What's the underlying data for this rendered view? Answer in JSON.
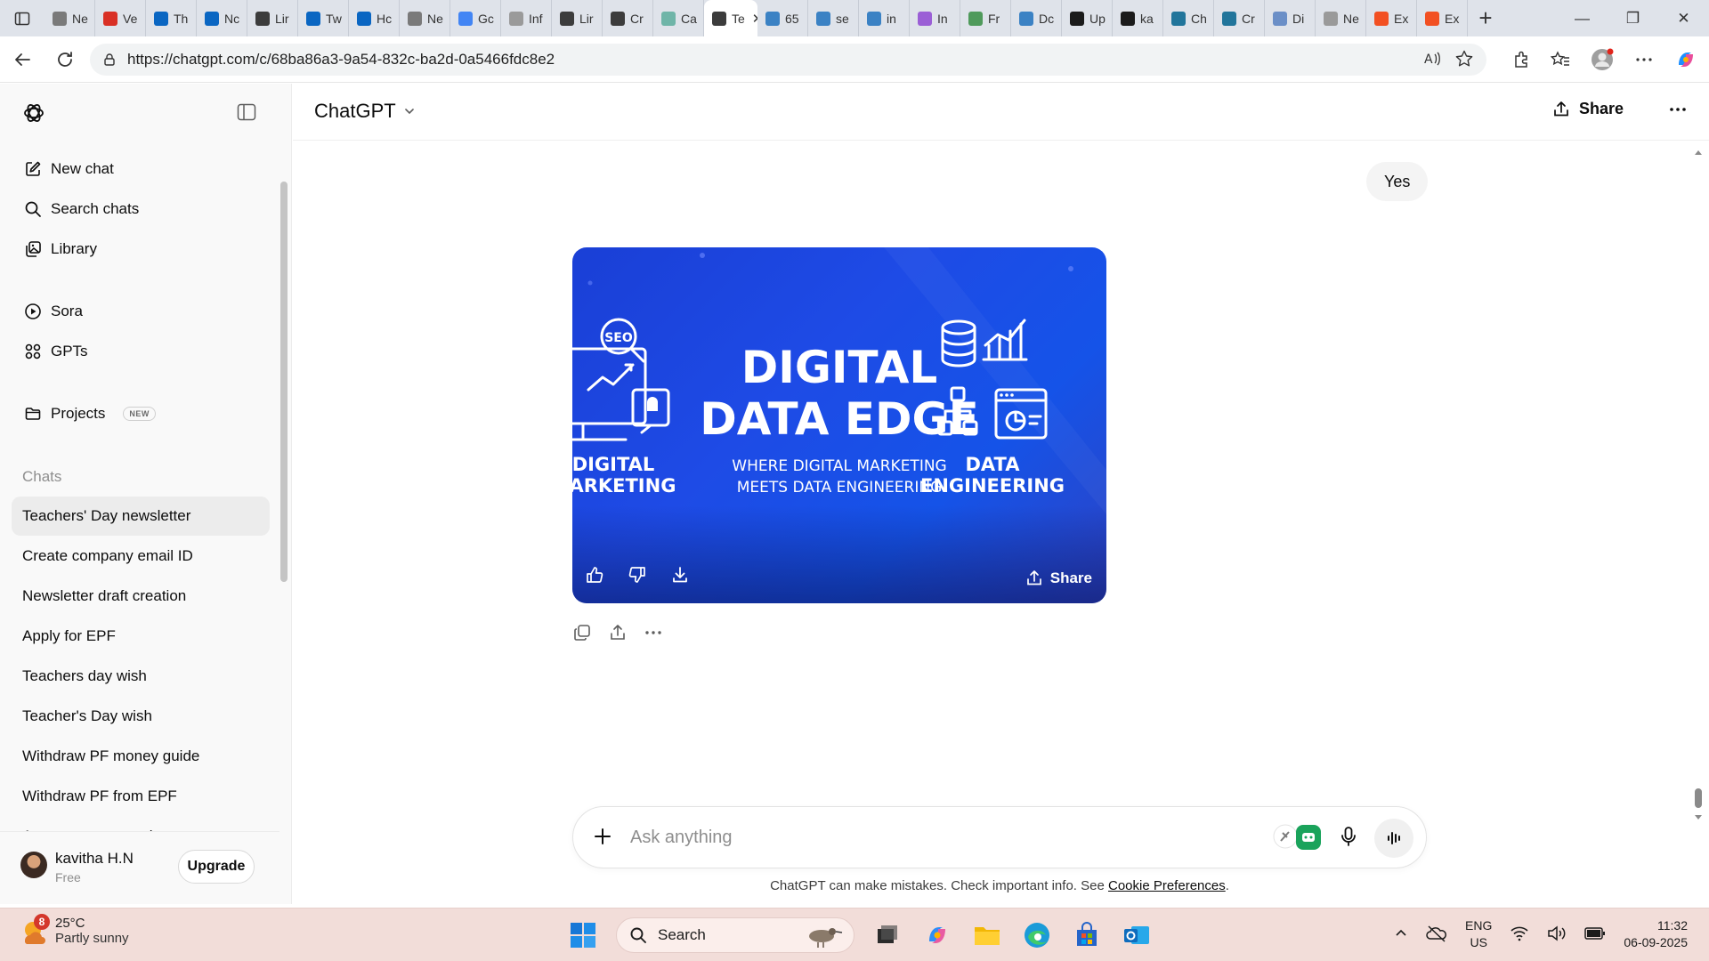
{
  "browser": {
    "tabs": [
      {
        "label": "Ne",
        "icon": "globe-icon",
        "color": "#7a7a7a"
      },
      {
        "label": "Ve",
        "icon": "gmail-icon",
        "color": "#d93025"
      },
      {
        "label": "Th",
        "icon": "linkedin-icon",
        "color": "#0a66c2"
      },
      {
        "label": "Nc",
        "icon": "linkedin-icon",
        "color": "#0a66c2"
      },
      {
        "label": "Lir",
        "icon": "chatgpt-icon",
        "color": "#3c3c3c"
      },
      {
        "label": "Tw",
        "icon": "linkedin-icon",
        "color": "#0a66c2"
      },
      {
        "label": "Hc",
        "icon": "linkedin-icon",
        "color": "#0a66c2"
      },
      {
        "label": "Ne",
        "icon": "globe-icon",
        "color": "#7a7a7a"
      },
      {
        "label": "Gc",
        "icon": "google-icon",
        "color": "#4285f4"
      },
      {
        "label": "Inf",
        "icon": "generic-icon",
        "color": "#9a9a9a"
      },
      {
        "label": "Lir",
        "icon": "chatgpt-icon",
        "color": "#3c3c3c"
      },
      {
        "label": "Cr",
        "icon": "chatgpt-icon",
        "color": "#3c3c3c"
      },
      {
        "label": "Ca",
        "icon": "chatgpt-icon",
        "color": "#6fb5a8"
      }
    ],
    "active_tab": {
      "label": "Te",
      "icon": "chatgpt-icon",
      "color": "#3c3c3c"
    },
    "tabs_after": [
      {
        "label": "65",
        "icon": "arrow-icon",
        "color": "#3b82c4"
      },
      {
        "label": "se",
        "icon": "arrow-icon",
        "color": "#3b82c4"
      },
      {
        "label": "in",
        "icon": "arrow-icon",
        "color": "#3b82c4"
      },
      {
        "label": "In",
        "icon": "b-icon",
        "color": "#9b5fd6"
      },
      {
        "label": "Fr",
        "icon": "leaf-icon",
        "color": "#4f9a5b"
      },
      {
        "label": "Dc",
        "icon": "arrow-icon",
        "color": "#3b82c4"
      },
      {
        "label": "Up",
        "icon": "github-icon",
        "color": "#1b1b1b"
      },
      {
        "label": "ka",
        "icon": "github-icon",
        "color": "#1b1b1b"
      },
      {
        "label": "Ch",
        "icon": "wordpress-icon",
        "color": "#21759b"
      },
      {
        "label": "Cr",
        "icon": "wordpress-icon",
        "color": "#21759b"
      },
      {
        "label": "Di",
        "icon": "search-icon",
        "color": "#6b8fc7"
      },
      {
        "label": "Ne",
        "icon": "window-icon",
        "color": "#9a9a9a"
      },
      {
        "label": "Ex",
        "icon": "ms-icon",
        "color": "#f25022"
      },
      {
        "label": "Ex",
        "icon": "ms-icon",
        "color": "#f25022"
      }
    ],
    "url": "https://chatgpt.com/c/68ba86a3-9a54-832c-ba2d-0a5466fdc8e2"
  },
  "sidebar": {
    "nav": [
      {
        "label": "New chat",
        "icon": "new-chat-icon"
      },
      {
        "label": "Search chats",
        "icon": "search-icon"
      },
      {
        "label": "Library",
        "icon": "library-icon"
      },
      {
        "label": "Sora",
        "icon": "play-circle-icon"
      },
      {
        "label": "GPTs",
        "icon": "gpts-grid-icon"
      },
      {
        "label": "Projects",
        "icon": "folder-icon",
        "badge": "NEW"
      }
    ],
    "section_title": "Chats",
    "chats": [
      "Teachers' Day newsletter",
      "Create company email ID",
      "Newsletter draft creation",
      "Apply for EPF",
      "Teachers day wish",
      "Teacher's Day wish",
      "Withdraw PF money guide",
      "Withdraw PF from EPF",
      "Apsara song meaning"
    ],
    "user": {
      "name": "kavitha H.N",
      "plan": "Free",
      "upgrade_label": "Upgrade"
    }
  },
  "main": {
    "model_label": "ChatGPT",
    "share_label": "Share",
    "user_message": "Yes",
    "image": {
      "title_line1": "DIGITAL",
      "title_line2": "DATA EDGE",
      "subtitle_line1": "WHERE DIGITAL MARKETING",
      "subtitle_line2": "MEETS DATA ENGINEERING",
      "left_label_line1": "DIGITAL",
      "left_label_line2": "MARKETING",
      "seo_text": "SEO",
      "right_label_line1": "DATA",
      "right_label_line2": "ENGINEERING",
      "share_label": "Share"
    },
    "composer_placeholder": "Ask anything",
    "disclaimer_text": "ChatGPT can make mistakes. Check important info. See ",
    "disclaimer_link": "Cookie Preferences",
    "disclaimer_end": "."
  },
  "taskbar": {
    "weather_badge": "8",
    "temperature": "25°C",
    "condition": "Partly sunny",
    "search_label": "Search",
    "lang_line1": "ENG",
    "lang_line2": "US",
    "time": "11:32",
    "date": "06-09-2025"
  },
  "colors": {
    "accent_image_blue": "#1e4be6",
    "sidebar_bg": "#f9f9f9",
    "taskbar_bg": "#f2ddd9"
  }
}
